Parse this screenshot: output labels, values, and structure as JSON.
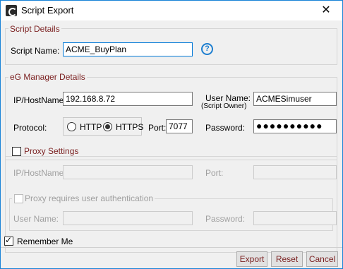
{
  "window": {
    "title": "Script Export",
    "close_glyph": "✕"
  },
  "script_details": {
    "legend": "Script Details",
    "name_label": "Script Name:",
    "name_value": "ACME_BuyPlan",
    "help_glyph": "?"
  },
  "manager": {
    "legend": "eG Manager Details",
    "host_label": "IP/HostName:",
    "host_value": "192.168.8.72",
    "user_label": "User Name:",
    "user_sublabel": "(Script Owner)",
    "user_value": "ACMESimuser",
    "protocol_label": "Protocol:",
    "protocol_options": [
      "HTTP",
      "HTTPS"
    ],
    "protocol_selected": "HTTPS",
    "port_label": "Port:",
    "port_value": "7077",
    "password_label": "Password:",
    "password_value": "●●●●●●●●●●"
  },
  "proxy": {
    "legend": "Proxy Settings",
    "checked": false,
    "host_label": "IP/HostName:",
    "host_value": "",
    "port_label": "Port:",
    "port_value": "",
    "auth_legend": "Proxy requires user authentication",
    "auth_checked": false,
    "user_label": "User Name:",
    "user_value": "",
    "password_label": "Password:",
    "password_value": ""
  },
  "remember": {
    "label": "Remember Me",
    "checked": true
  },
  "buttons": {
    "export": "Export",
    "reset": "Reset",
    "cancel": "Cancel"
  }
}
